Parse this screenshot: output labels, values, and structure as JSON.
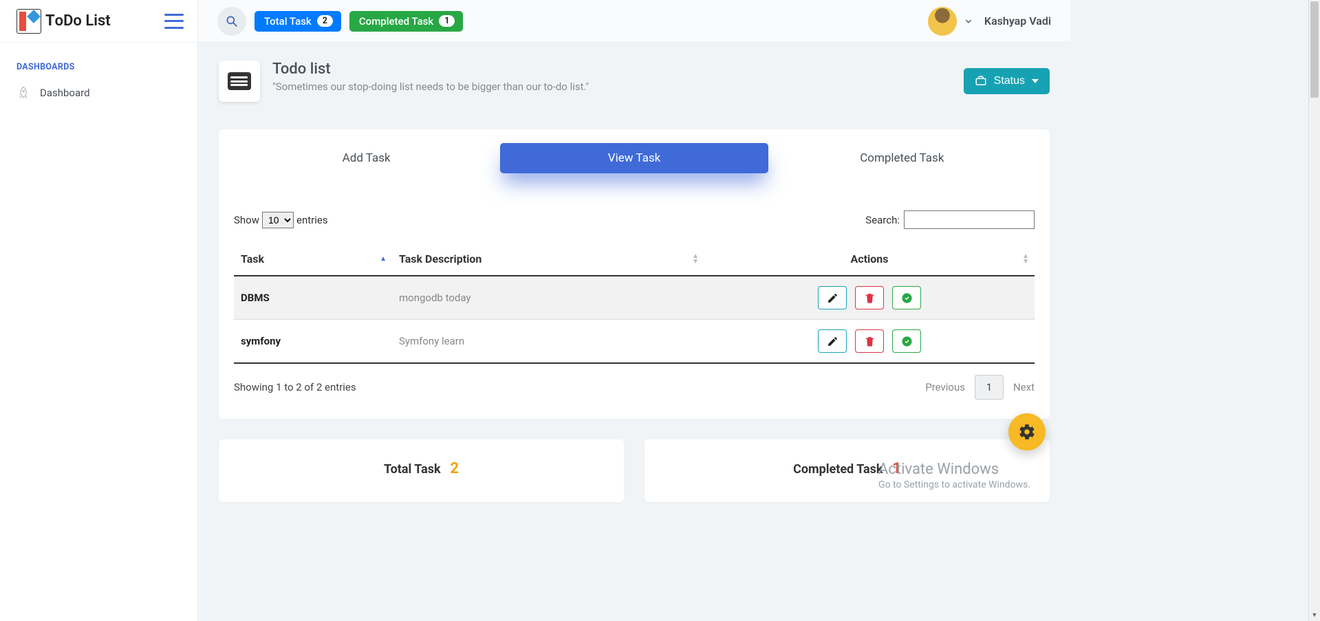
{
  "brand": {
    "name": "ToDo List"
  },
  "sidebar": {
    "section": "DASHBOARDS",
    "items": [
      {
        "label": "Dashboard"
      }
    ]
  },
  "topbar": {
    "total_label": "Total Task",
    "total_count": "2",
    "completed_label": "Completed Task",
    "completed_count": "1"
  },
  "user": {
    "name": "Kashyap Vadi"
  },
  "page": {
    "title": "Todo list",
    "subtitle": "\"Sometimes our stop-doing list needs to be bigger than our to-do list.\"",
    "status_label": "Status"
  },
  "tabs": {
    "add": "Add Task",
    "view": "View Task",
    "completed": "Completed Task"
  },
  "table": {
    "show_prefix": "Show",
    "show_suffix": "entries",
    "length_value": "10",
    "search_label": "Search:",
    "columns": {
      "task": "Task",
      "desc": "Task Description",
      "actions": "Actions"
    },
    "rows": [
      {
        "task": "DBMS",
        "desc": "mongodb today"
      },
      {
        "task": "symfony",
        "desc": "Symfony learn"
      }
    ],
    "info": "Showing 1 to 2 of 2 entries",
    "prev": "Previous",
    "page": "1",
    "next": "Next"
  },
  "summary": {
    "total_label": "Total Task",
    "total_value": "2",
    "completed_label": "Completed Task",
    "completed_value": "1"
  },
  "watermark": {
    "line1": "Activate Windows",
    "line2": "Go to Settings to activate Windows."
  }
}
